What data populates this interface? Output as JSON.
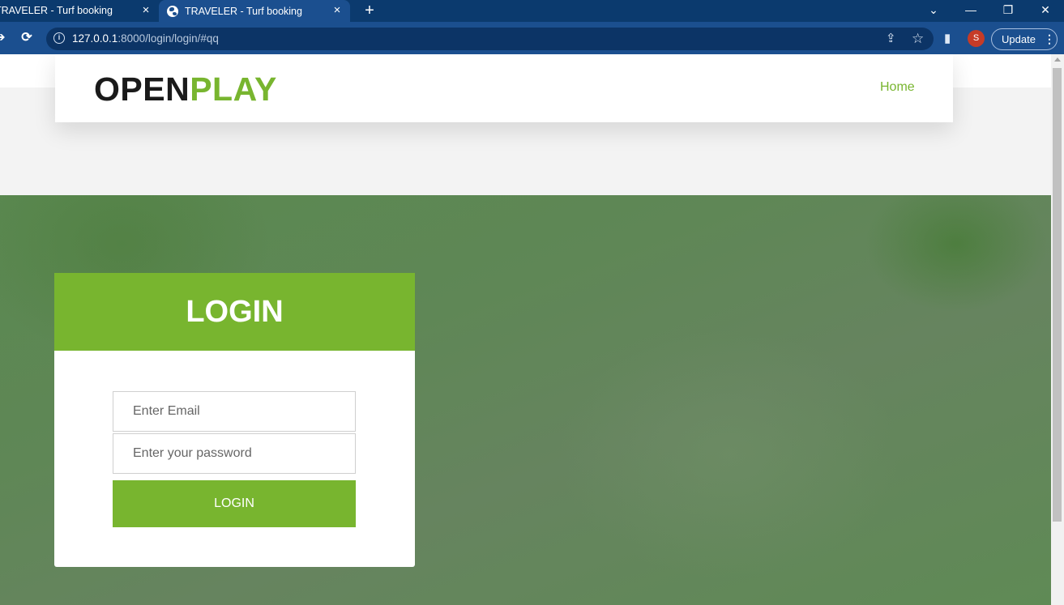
{
  "browser": {
    "tabs": [
      {
        "title": "TRAVELER - Turf booking",
        "active": false
      },
      {
        "title": "TRAVELER - Turf booking",
        "active": true
      }
    ],
    "url_host": "127.0.0.1",
    "url_path": ":8000/login/login/#qq",
    "profile_initial": "S",
    "update_label": "Update",
    "icons": {
      "close_tab": "×",
      "new_tab": "+",
      "tab_search": "⌄",
      "minimize": "—",
      "restore": "❐",
      "close_window": "✕",
      "back": "➔",
      "reload": "⟳",
      "share": "⇪",
      "star": "☆",
      "side_panel": "▮",
      "menu": "⋮"
    }
  },
  "header": {
    "logo_part1": "OPEN",
    "logo_part2": "PLAY",
    "nav_home": "Home"
  },
  "login": {
    "title": "LOGIN",
    "email_placeholder": "Enter Email",
    "password_placeholder": "Enter your password",
    "button_label": "LOGIN"
  },
  "colors": {
    "accent": "#78b52f",
    "browser_frame": "#0b3a6e",
    "browser_toolbar": "#1b4f8f"
  }
}
